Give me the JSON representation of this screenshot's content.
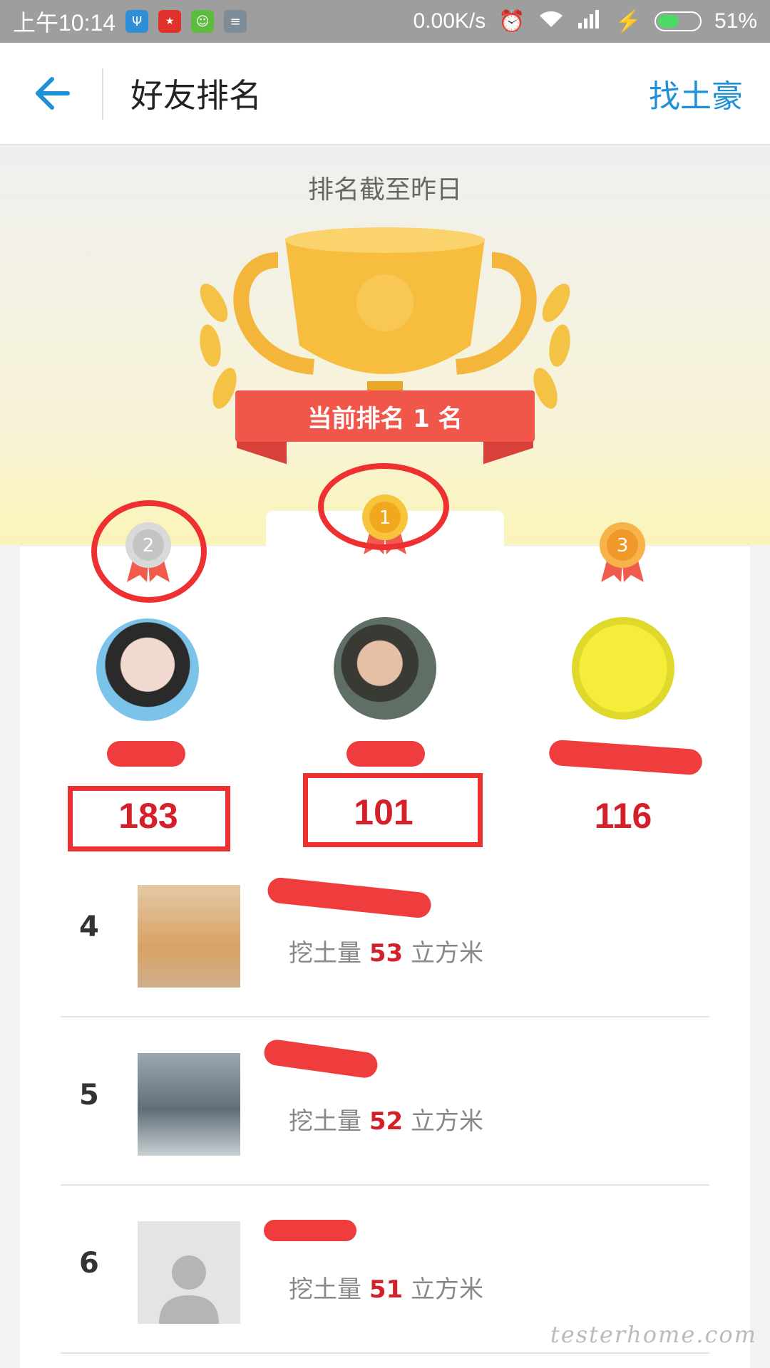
{
  "status_bar": {
    "time": "上午10:14",
    "net_speed": "0.00K/s",
    "battery": "51%",
    "battery_level": 0.51,
    "apps": [
      "usb-icon",
      "app-red-icon",
      "app-green-icon",
      "app-grey-icon"
    ]
  },
  "nav": {
    "title": "好友排名",
    "action": "找土豪",
    "back_icon": "arrow-left-icon"
  },
  "hero": {
    "caption": "排名截至昨日",
    "rank_banner": "当前排名 1 名"
  },
  "podium": [
    {
      "place": 2,
      "score": "183"
    },
    {
      "place": 1,
      "score": "101"
    },
    {
      "place": 3,
      "score": "116"
    }
  ],
  "list": [
    {
      "rank": "4",
      "dig_prefix": "挖土量",
      "dig_value": "53",
      "dig_unit": "立方米"
    },
    {
      "rank": "5",
      "dig_prefix": "挖土量",
      "dig_value": "52",
      "dig_unit": "立方米"
    },
    {
      "rank": "6",
      "dig_prefix": "挖土量",
      "dig_value": "51",
      "dig_unit": "立方米"
    }
  ],
  "watermark": "testerhome.com",
  "colors": {
    "accent": "#1e90d8",
    "score": "#d4202a",
    "annotation": "#ef3030"
  }
}
